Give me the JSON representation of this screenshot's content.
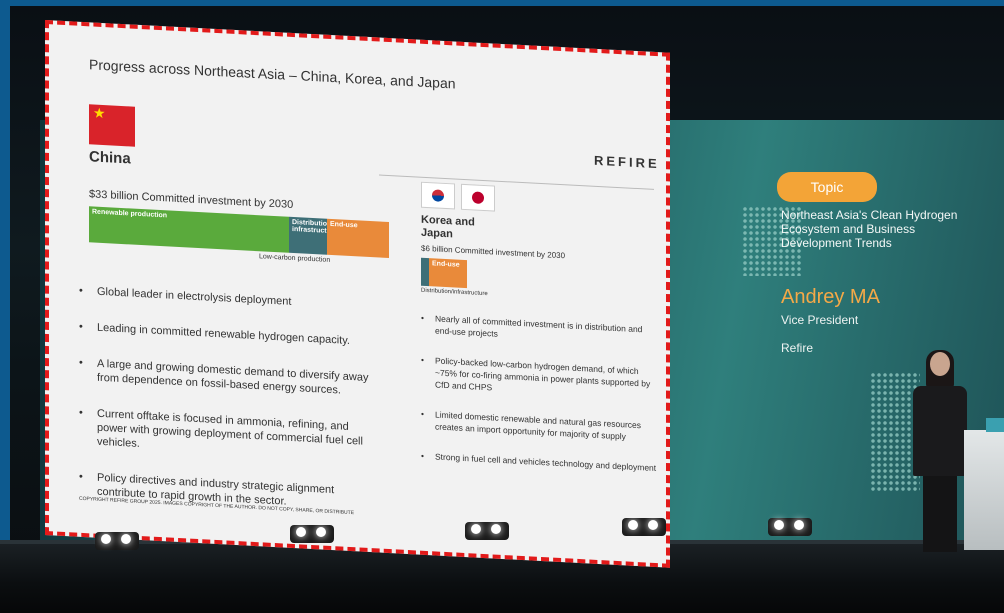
{
  "slide": {
    "title": "Progress across Northeast Asia – China, Korea, and Japan",
    "logo": "REFIRE",
    "china": {
      "label": "China",
      "investment": "$33 billion Committed investment by 2030",
      "bar_labels": [
        "Renewable production",
        "Distribution/ infrastructure",
        "End-use"
      ],
      "sub_label": "Low-carbon production",
      "bullets": [
        "Global leader in electrolysis deployment",
        "Leading in committed renewable hydrogen capacity.",
        "A large and growing domestic demand to diversify away from dependence on fossil-based energy sources.",
        "Current offtake is focused in ammonia, refining, and power with growing deployment of commercial fuel cell vehicles.",
        "Policy directives and industry strategic alignment contribute to rapid growth in the sector."
      ]
    },
    "korea_japan": {
      "label": "Korea and Japan",
      "investment": "$6 billion Committed investment by 2030",
      "bar_label": "End-use",
      "sub_label": "Distribution/infrastructure",
      "bullets": [
        "Nearly all of committed investment is in distribution and end-use projects",
        "Policy-backed low-carbon hydrogen demand, of which ~75% for co-firing ammonia in power plants supported by CfD and CHPS",
        "Limited domestic renewable and natural gas resources creates an import opportunity for majority of supply",
        "Strong in fuel cell and vehicles technology and deployment"
      ]
    },
    "copyright": "COPYRIGHT REFIRE GROUP 2025. IMAGES COPYRIGHT OF THE AUTHOR. DO NOT COPY, SHARE, OR DISTRIBUTE"
  },
  "info": {
    "topic_label": "Topic",
    "topic_title": "Northeast Asia's Clean Hydrogen Ecosystem and Business Development Trends",
    "speaker_name": "Andrey MA",
    "speaker_role": "Vice President",
    "speaker_org": "Refire"
  },
  "colors": {
    "highlight_border": "#e21a1a",
    "accent_orange": "#f3a437",
    "bar_green": "#5aaa3c",
    "bar_teal": "#3e6f77",
    "bar_orange": "#e98a3a"
  }
}
